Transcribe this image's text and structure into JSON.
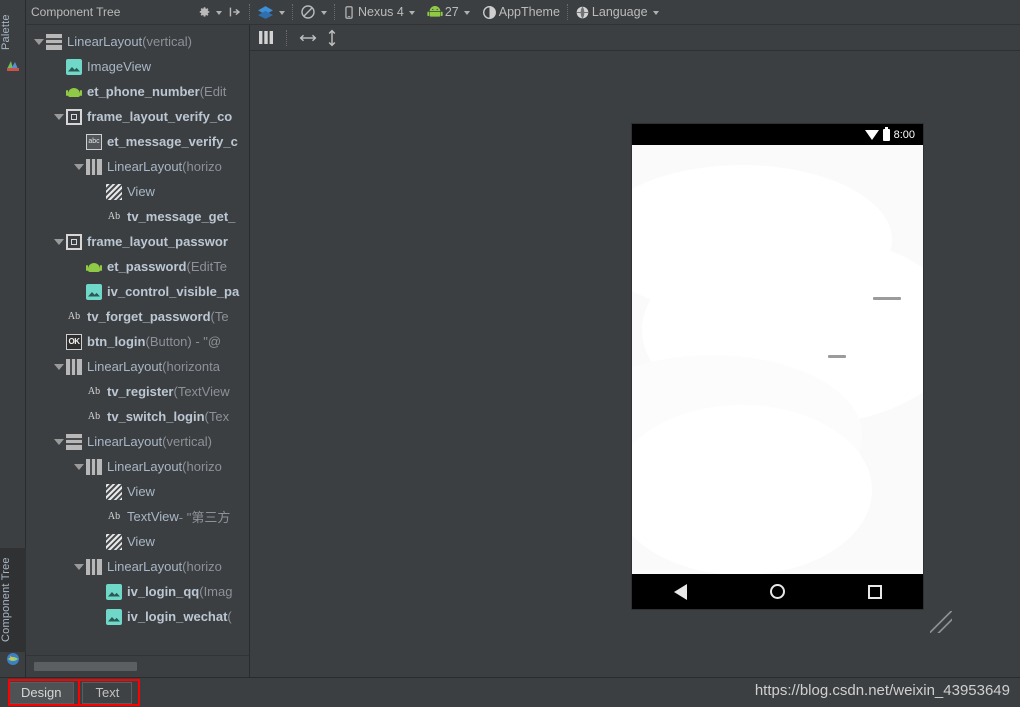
{
  "edge_tabs": {
    "palette": "Palette",
    "component_tree": "Component Tree"
  },
  "toolbar": {
    "title": "Component Tree",
    "settings_icon": "gear-icon",
    "expand_icon": "expand-panel-icon",
    "layers_icon": "layers-icon",
    "orientation_icon": "orientation-no-icon",
    "device": {
      "icon": "phone-icon",
      "label": "Nexus 4"
    },
    "api": {
      "icon": "android-icon",
      "label": "27"
    },
    "theme": {
      "icon": "theme-contrast-icon",
      "label": "AppTheme"
    },
    "language": {
      "icon": "globe-icon",
      "label": "Language"
    }
  },
  "subbar": {
    "columns_icon": "columns-icon",
    "width_icon": "horizontal-resize-icon",
    "height_icon": "vertical-resize-icon"
  },
  "tree": {
    "items": [
      {
        "indent": 0,
        "twisty": true,
        "icon": "linearlayout-vertical-icon",
        "name": "LinearLayout",
        "type": " (vertical)",
        "bold": false
      },
      {
        "indent": 1,
        "twisty": false,
        "icon": "imageview-icon",
        "name": "ImageView",
        "type": "",
        "bold": false
      },
      {
        "indent": 1,
        "twisty": false,
        "icon": "edittext-android-icon",
        "name": "et_phone_number",
        "type": " (Edit",
        "bold": true
      },
      {
        "indent": 1,
        "twisty": true,
        "icon": "framelayout-icon",
        "name": "frame_layout_verify_co",
        "type": "",
        "bold": true
      },
      {
        "indent": 2,
        "twisty": false,
        "icon": "abc-edittext-icon",
        "name": "et_message_verify_c",
        "type": "",
        "bold": true
      },
      {
        "indent": 2,
        "twisty": true,
        "icon": "linearlayout-horizontal-icon",
        "name": "LinearLayout",
        "type": " (horizo",
        "bold": false
      },
      {
        "indent": 3,
        "twisty": false,
        "icon": "view-icon",
        "name": "View",
        "type": "",
        "bold": false
      },
      {
        "indent": 3,
        "twisty": false,
        "icon": "textview-ab-icon",
        "name": "tv_message_get_",
        "type": "",
        "bold": true
      },
      {
        "indent": 1,
        "twisty": true,
        "icon": "framelayout-icon",
        "name": "frame_layout_passwor",
        "type": "",
        "bold": true
      },
      {
        "indent": 2,
        "twisty": false,
        "icon": "edittext-android-icon",
        "name": "et_password",
        "type": " (EditTe",
        "bold": true
      },
      {
        "indent": 2,
        "twisty": false,
        "icon": "imageview-icon",
        "name": "iv_control_visible_pa",
        "type": "",
        "bold": true
      },
      {
        "indent": 1,
        "twisty": false,
        "icon": "textview-ab-icon",
        "name": "tv_forget_password",
        "type": " (Te",
        "bold": true
      },
      {
        "indent": 1,
        "twisty": false,
        "icon": "button-ok-icon",
        "name": "btn_login",
        "type": " (Button) - \"@",
        "bold": true
      },
      {
        "indent": 1,
        "twisty": true,
        "icon": "linearlayout-horizontal-icon",
        "name": "LinearLayout",
        "type": " (horizonta",
        "bold": false
      },
      {
        "indent": 2,
        "twisty": false,
        "icon": "textview-ab-icon",
        "name": "tv_register",
        "type": " (TextView",
        "bold": true
      },
      {
        "indent": 2,
        "twisty": false,
        "icon": "textview-ab-icon",
        "name": "tv_switch_login",
        "type": " (Tex",
        "bold": true
      },
      {
        "indent": 1,
        "twisty": true,
        "icon": "linearlayout-vertical-icon",
        "name": "LinearLayout",
        "type": " (vertical)",
        "bold": false
      },
      {
        "indent": 2,
        "twisty": true,
        "icon": "linearlayout-horizontal-icon",
        "name": "LinearLayout",
        "type": " (horizo",
        "bold": false
      },
      {
        "indent": 3,
        "twisty": false,
        "icon": "view-icon",
        "name": "View",
        "type": "",
        "bold": false
      },
      {
        "indent": 3,
        "twisty": false,
        "icon": "textview-ab-icon",
        "name": "TextView",
        "type": " - \"第三方",
        "bold": false
      },
      {
        "indent": 3,
        "twisty": false,
        "icon": "view-icon",
        "name": "View",
        "type": "",
        "bold": false
      },
      {
        "indent": 2,
        "twisty": true,
        "icon": "linearlayout-horizontal-icon",
        "name": "LinearLayout",
        "type": " (horizo",
        "bold": false
      },
      {
        "indent": 3,
        "twisty": false,
        "icon": "imageview-icon",
        "name": "iv_login_qq",
        "type": " (Imag",
        "bold": true
      },
      {
        "indent": 3,
        "twisty": false,
        "icon": "imageview-icon",
        "name": "iv_login_wechat",
        "type": " (",
        "bold": true
      }
    ]
  },
  "device_preview": {
    "status_time": "8:00",
    "wifi_icon": "wifi-icon",
    "battery_icon": "battery-icon",
    "nav_back_icon": "nav-back-icon",
    "nav_home_icon": "nav-home-icon",
    "nav_recents_icon": "nav-recents-icon"
  },
  "bottom_tabs": {
    "design": "Design",
    "text": "Text"
  },
  "watermark": "https://blog.csdn.net/weixin_43953649",
  "colors": {
    "background": "#3c3f41",
    "panel_text": "#a9b7c6",
    "type_text": "#8d9199",
    "accent_red": "#ff0000",
    "device_white": "#fafafa",
    "android_green": "#8fc946",
    "imageview_teal": "#6fd8c8"
  }
}
